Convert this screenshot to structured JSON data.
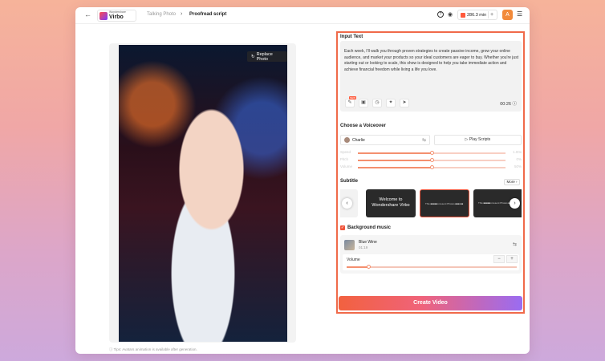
{
  "topbar": {
    "back_icon": "arrow-left-icon",
    "brand_small": "Wondershare",
    "brand_big": "Virbo",
    "breadcrumb_parent": "Talking Photo",
    "breadcrumb_current": "Proofread script",
    "credits": "286.3 min",
    "avatar_letter": "A"
  },
  "left": {
    "replace_photo": "Replace Photo",
    "note": "Tips: Avatars animation is available after generation."
  },
  "input_text": {
    "title": "Input Text",
    "content": "Each week, I'll walk you through proven strategies to create passive income, grow your online audience, and market your products so your ideal customers are eager to buy. Whether you're just starting out or looking to scale, this show is designed to help you take immediate action and achieve financial freedom while living a life you love.",
    "badge": "NEW",
    "duration": "00:26"
  },
  "voiceover": {
    "title": "Choose a Voiceover",
    "voice": "Charlie",
    "play_label": "Play Scripts",
    "sliders": [
      {
        "label": "Speed",
        "value": "1.00x",
        "level": 0.5
      },
      {
        "label": "Pitch",
        "value": "0%",
        "level": 0.5
      },
      {
        "label": "Volume",
        "value": "50%",
        "level": 0.5
      }
    ]
  },
  "subtitle": {
    "title": "Subtitle",
    "more": "More",
    "cards": [
      {
        "line1": "Welcome to",
        "line2": "Wondershare Virbo"
      },
      {
        "stripe": "This ■■■■■ present Photos ■■■ ■■"
      },
      {
        "stripe": "This ■■■■■ present Photos ■■■"
      }
    ]
  },
  "music": {
    "title": "Background music",
    "name": "Blue Wine",
    "time": "01:19",
    "volume_label": "Volume",
    "volume_level": 0.13
  },
  "create_button": "Create Video",
  "colors": {
    "accent": "#f0553b",
    "button_gradient_end": "#9a6cf2"
  }
}
